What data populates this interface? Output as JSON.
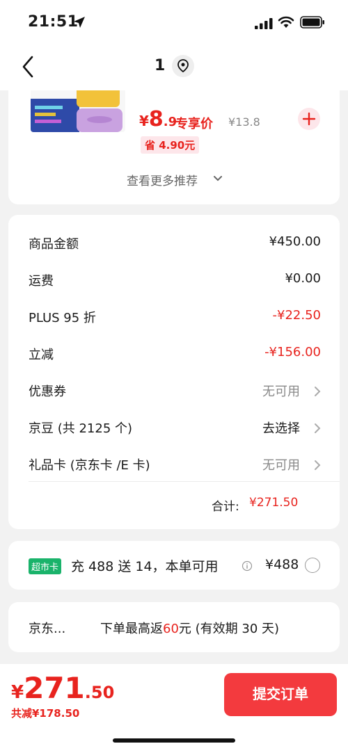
{
  "status_bar": {
    "time": "21:51"
  },
  "nav": {
    "title": "1"
  },
  "recommendation": {
    "price_yen": "¥",
    "price_int": "8",
    "price_dec": ".9",
    "exclusive_label": "专享价",
    "original_price": "¥13.8",
    "save_label": "省 4.90元",
    "view_more": "查看更多推荐"
  },
  "summary": {
    "rows": [
      {
        "label": "商品金额",
        "value": "¥450.00"
      },
      {
        "label": "运费",
        "value": "¥0.00"
      },
      {
        "label": "PLUS 95 折",
        "value": "-¥22.50"
      },
      {
        "label": "立减",
        "value": "-¥156.00"
      },
      {
        "label": "优惠券",
        "value": "无可用"
      },
      {
        "label": "京豆 (共 2125 个)",
        "value": "去选择"
      },
      {
        "label": "礼品卡 (京东卡 /E 卡)",
        "value": "无可用"
      }
    ],
    "total_label": "合计:",
    "total_value": "¥271.50"
  },
  "market_card": {
    "badge": "超市卡",
    "text": "充 488 送 14，本单可用",
    "price": "¥488"
  },
  "jd_card": {
    "label": "京东...",
    "promo_prefix": "下单最高返",
    "promo_highlight": "60",
    "promo_suffix": "元 (有效期 30 天)"
  },
  "footer": {
    "price_yen": "¥",
    "price_int": "271",
    "price_dec": ".50",
    "total_saving": "共减¥178.50",
    "submit_label": "提交订单"
  },
  "colors": {
    "accent_red": "#e8231e",
    "submit_bg": "#f33a3e",
    "market_green": "#1ab36b"
  }
}
